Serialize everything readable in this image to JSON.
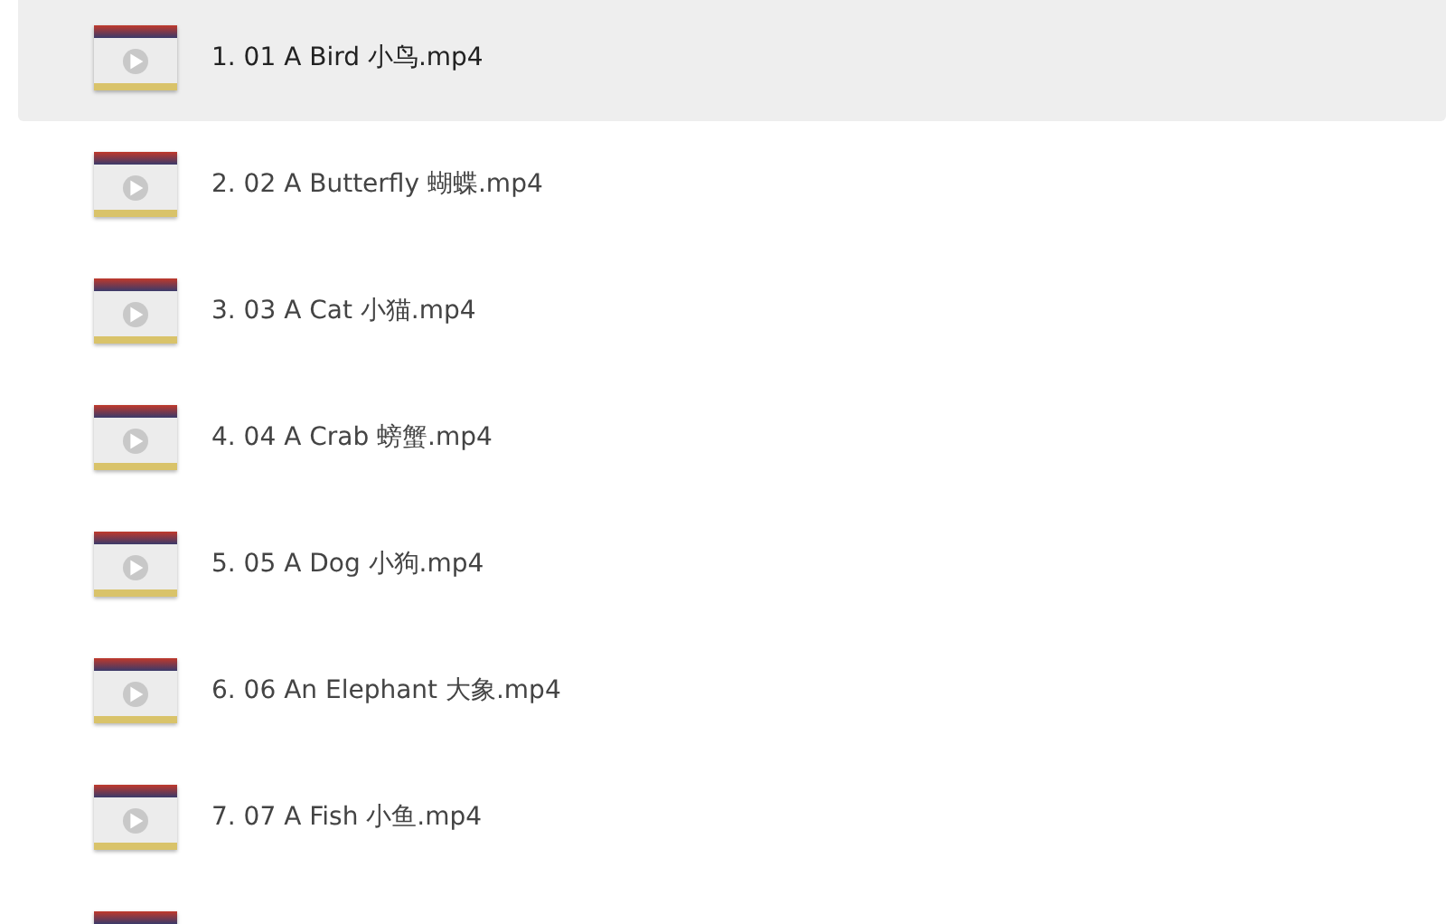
{
  "videos": [
    {
      "label": "1. 01 A Bird 小鸟.mp4",
      "selected": true
    },
    {
      "label": "2. 02 A Butterfly 蝴蝶.mp4",
      "selected": false
    },
    {
      "label": "3. 03 A Cat 小猫.mp4",
      "selected": false
    },
    {
      "label": "4. 04 A Crab 螃蟹.mp4",
      "selected": false
    },
    {
      "label": "5. 05 A Dog 小狗.mp4",
      "selected": false
    },
    {
      "label": "6. 06 An Elephant 大象.mp4",
      "selected": false
    },
    {
      "label": "7. 07 A Fish 小鱼.mp4",
      "selected": false
    },
    {
      "selected": false
    }
  ]
}
